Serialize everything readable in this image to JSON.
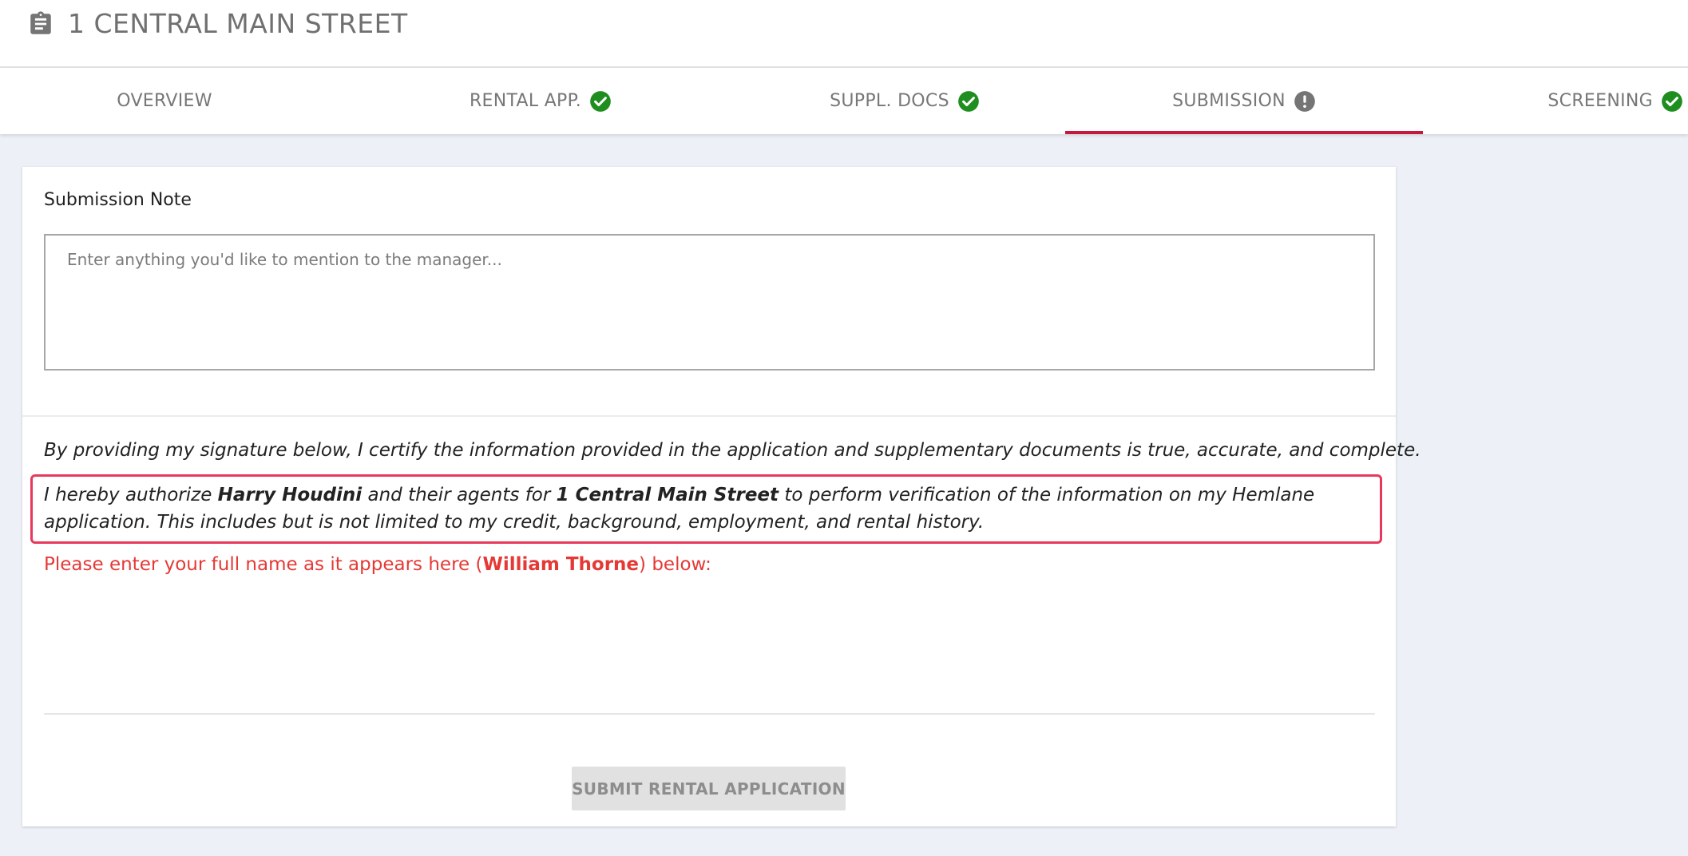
{
  "header": {
    "icon": "clipboard-icon",
    "title": "1 CENTRAL MAIN STREET"
  },
  "tabs": [
    {
      "label": "OVERVIEW",
      "status": "none"
    },
    {
      "label": "RENTAL APP.",
      "status": "complete",
      "icon": "check-circle-icon",
      "color": "#1e8e1e"
    },
    {
      "label": "SUPPL. DOCS",
      "status": "complete",
      "icon": "check-circle-icon",
      "color": "#1e8e1e"
    },
    {
      "label": "SUBMISSION",
      "status": "attention",
      "icon": "exclamation-circle-icon",
      "color": "#757575",
      "active": true
    },
    {
      "label": "SCREENING",
      "status": "complete",
      "icon": "check-circle-icon",
      "color": "#1e8e1e"
    }
  ],
  "submission": {
    "note_label": "Submission Note",
    "note_placeholder": "Enter anything you'd like to mention to the manager...",
    "note_value": "",
    "certify_text": "By providing my signature below, I certify the information provided in the application and supplementary documents is true, accurate, and complete.",
    "auth": {
      "prefix": "I hereby authorize ",
      "manager": "Harry Houdini",
      "middle": " and their agents for ",
      "property": "1 Central Main Street",
      "suffix": " to perform verification of the information on my Hemlane application. This includes but is not limited to my credit, background, employment, and rental history."
    },
    "sign_prompt": {
      "prefix": "Please enter your full name as it appears here (",
      "name": "William Thorne",
      "suffix": ") below:"
    },
    "signature_value": "",
    "submit_label": "SUBMIT RENTAL APPLICATION"
  },
  "colors": {
    "accent": "#c8173f",
    "highlight_border": "#e8395d",
    "warning_text": "#e53935",
    "complete": "#1e8e1e",
    "pending": "#757575"
  }
}
